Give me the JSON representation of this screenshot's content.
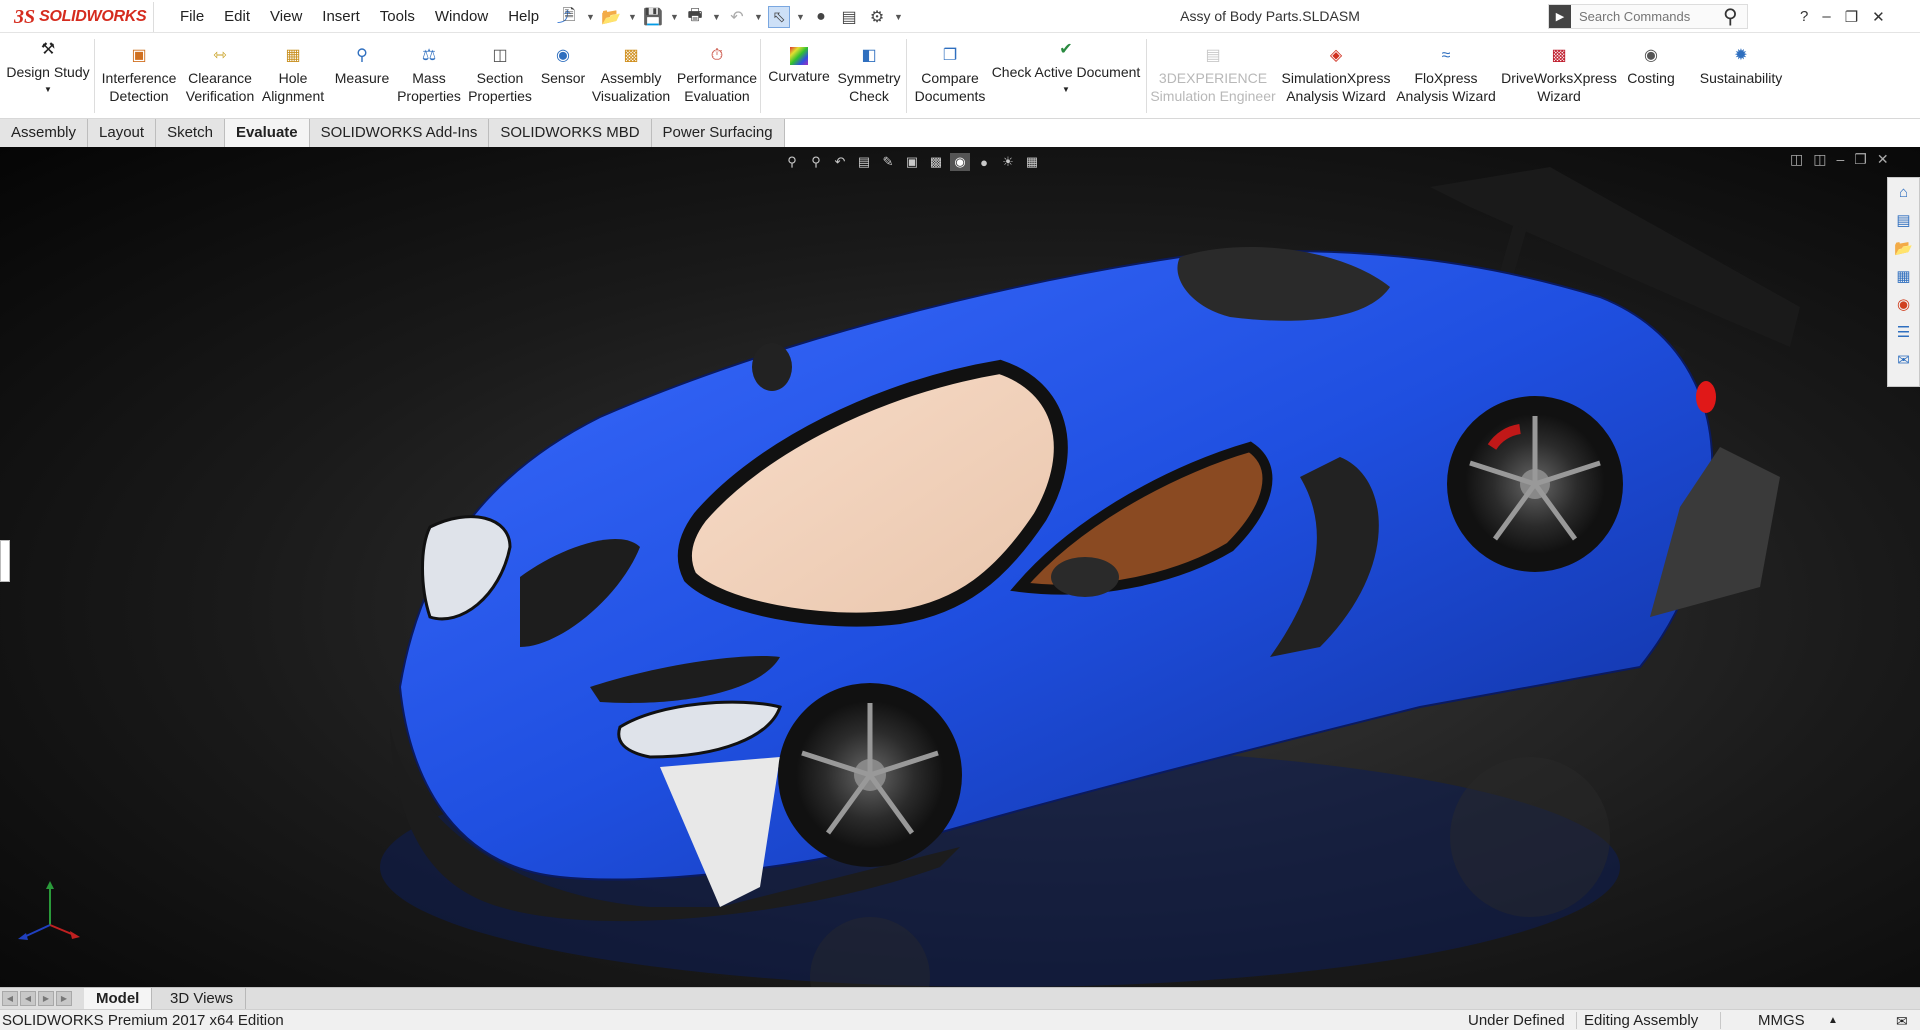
{
  "app": {
    "logo_ds": "3S",
    "logo_text": "SOLIDWORKS",
    "document_title": "Assy of Body Parts.SLDASM"
  },
  "menu": [
    "File",
    "Edit",
    "View",
    "Insert",
    "Tools",
    "Window",
    "Help"
  ],
  "search": {
    "placeholder": "Search Commands"
  },
  "ribbon": {
    "design_study": "Design Study",
    "interference_detection": "Interference\nDetection",
    "clearance_verification": "Clearance\nVerification",
    "hole_alignment": "Hole\nAlignment",
    "measure": "Measure",
    "mass_properties": "Mass\nProperties",
    "section_properties": "Section\nProperties",
    "sensor": "Sensor",
    "assembly_visualization": "Assembly\nVisualization",
    "performance_evaluation": "Performance\nEvaluation",
    "curvature": "Curvature",
    "symmetry_check": "Symmetry\nCheck",
    "compare_documents": "Compare\nDocuments",
    "check_active_document": "Check Active Document",
    "simulation_engineer": "3DEXPERIENCE\nSimulation Engineer",
    "simulationxpress": "SimulationXpress\nAnalysis Wizard",
    "floxpress": "FloXpress\nAnalysis Wizard",
    "driveworksxpress": "DriveWorksXpress\nWizard",
    "costing": "Costing",
    "sustainability": "Sustainability"
  },
  "tabs": [
    "Assembly",
    "Layout",
    "Sketch",
    "Evaluate",
    "SOLIDWORKS Add-Ins",
    "SOLIDWORKS MBD",
    "Power Surfacing"
  ],
  "active_tab": "Evaluate",
  "bottom_tabs": [
    "Model",
    "3D Views"
  ],
  "status": {
    "edition": "SOLIDWORKS Premium 2017 x64 Edition",
    "state": "Under Defined",
    "mode": "Editing Assembly",
    "units": "MMGS"
  },
  "colors": {
    "brand_red": "#d52b1e",
    "car_body": "#1f4fe0",
    "viewport_bg": "#111111"
  }
}
